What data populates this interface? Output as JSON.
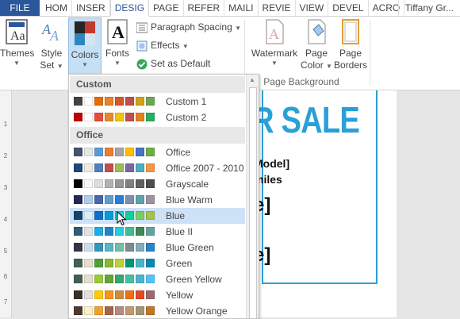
{
  "tabbar": {
    "file": "FILE",
    "tabs": [
      "HOM",
      "INSER",
      "DESIG",
      "PAGE",
      "REFER",
      "MAILI",
      "REVIE",
      "VIEW",
      "DEVEL",
      "ACRO"
    ],
    "active_tab": "DESIG",
    "user": "Tiffany Gr..."
  },
  "ribbon": {
    "themes": "Themes",
    "style_set": [
      "Style",
      "Set"
    ],
    "colors": "Colors",
    "fonts": "Fonts",
    "paragraph_spacing": "Paragraph Spacing",
    "effects": "Effects",
    "set_as_default": "Set as Default",
    "watermark": "Watermark",
    "page_color": [
      "Page",
      "Color"
    ],
    "page_borders": [
      "Page",
      "Borders"
    ],
    "group_label": "Page Background",
    "icons": {
      "themes": "themes-icon",
      "style_set": "style-set-icon",
      "colors": "colors-palette-icon",
      "fonts": "fonts-icon",
      "paragraph_spacing": "paragraph-spacing-icon",
      "effects": "effects-icon",
      "set_as_default": "checkmark-icon",
      "watermark": "watermark-icon",
      "page_color": "page-color-icon",
      "page_borders": "page-borders-icon"
    }
  },
  "ruler": {
    "ticks": [
      "1",
      "2",
      "3",
      "4",
      "5",
      "6",
      "7"
    ]
  },
  "document": {
    "headline": "R SALE",
    "lines": [
      "Model]",
      "miles",
      "e]",
      "e]"
    ]
  },
  "dropdown": {
    "sections": [
      {
        "title": "Custom",
        "items": [
          {
            "name": "Custom 1",
            "swatches": [
              "#444444",
              "#ffffff",
              "#e46c0a",
              "#e8822c",
              "#d4582a",
              "#c0504d",
              "#d4a017",
              "#6aa84f"
            ]
          },
          {
            "name": "Custom 2",
            "swatches": [
              "#c00000",
              "#ffffff",
              "#e84c3d",
              "#e68a2e",
              "#f1c40f",
              "#c0504d",
              "#e67e22",
              "#27ae60"
            ]
          }
        ]
      },
      {
        "title": "Office",
        "items": [
          {
            "name": "Office",
            "swatches": [
              "#44546a",
              "#e7e6e6",
              "#5b9bd5",
              "#ed7d31",
              "#a5a5a5",
              "#ffc000",
              "#4472c4",
              "#70ad47"
            ]
          },
          {
            "name": "Office 2007 - 2010",
            "swatches": [
              "#1f497d",
              "#eeece1",
              "#4f81bd",
              "#c0504d",
              "#9bbb59",
              "#8064a2",
              "#4bacc6",
              "#f79646"
            ]
          },
          {
            "name": "Grayscale",
            "swatches": [
              "#000000",
              "#f8f8f8",
              "#dddddd",
              "#b2b2b2",
              "#969696",
              "#808080",
              "#5f5f5f",
              "#4d4d4d"
            ]
          },
          {
            "name": "Blue Warm",
            "swatches": [
              "#242852",
              "#acccea",
              "#4a66ac",
              "#629dd1",
              "#297fd5",
              "#7f8fa9",
              "#5aa2ae",
              "#9d90a0"
            ]
          },
          {
            "name": "Blue",
            "swatches": [
              "#17406d",
              "#dbeff9",
              "#0f6fc6",
              "#009dd9",
              "#0bd0d9",
              "#10cf9b",
              "#7cca62",
              "#a5c249"
            ]
          },
          {
            "name": "Blue II",
            "swatches": [
              "#335b74",
              "#dfe3e5",
              "#1cade4",
              "#2683c6",
              "#27ced7",
              "#42ba97",
              "#3e8853",
              "#62a39f"
            ]
          },
          {
            "name": "Blue Green",
            "swatches": [
              "#373545",
              "#ceddea",
              "#3494ba",
              "#58b6c0",
              "#75bda7",
              "#7a8c8e",
              "#84acb6",
              "#2683c6"
            ]
          },
          {
            "name": "Green",
            "swatches": [
              "#455f51",
              "#e3ded1",
              "#549e39",
              "#8ab833",
              "#c0cf3a",
              "#029676",
              "#4ab5c4",
              "#0989b1"
            ]
          },
          {
            "name": "Green Yellow",
            "swatches": [
              "#455f51",
              "#e3ded1",
              "#99cb38",
              "#63a537",
              "#37a76f",
              "#44c1a3",
              "#4eb3cf",
              "#51c3f9"
            ]
          },
          {
            "name": "Yellow",
            "swatches": [
              "#39302a",
              "#e5dedb",
              "#ffca08",
              "#f8931d",
              "#ce8d3e",
              "#ec7016",
              "#e64823",
              "#9c6a6a"
            ]
          },
          {
            "name": "Yellow Orange",
            "swatches": [
              "#4e3b30",
              "#fbeec9",
              "#f0a22e",
              "#a5644e",
              "#b58b80",
              "#c3986d",
              "#a19574",
              "#c17529"
            ]
          }
        ]
      }
    ],
    "selected": "Blue"
  },
  "colors": {
    "accent": "#2b579a",
    "selected_bg": "#cde2f7",
    "ribbon_pressed": "#c5dff5",
    "sale_text": "#2aa0d8"
  }
}
